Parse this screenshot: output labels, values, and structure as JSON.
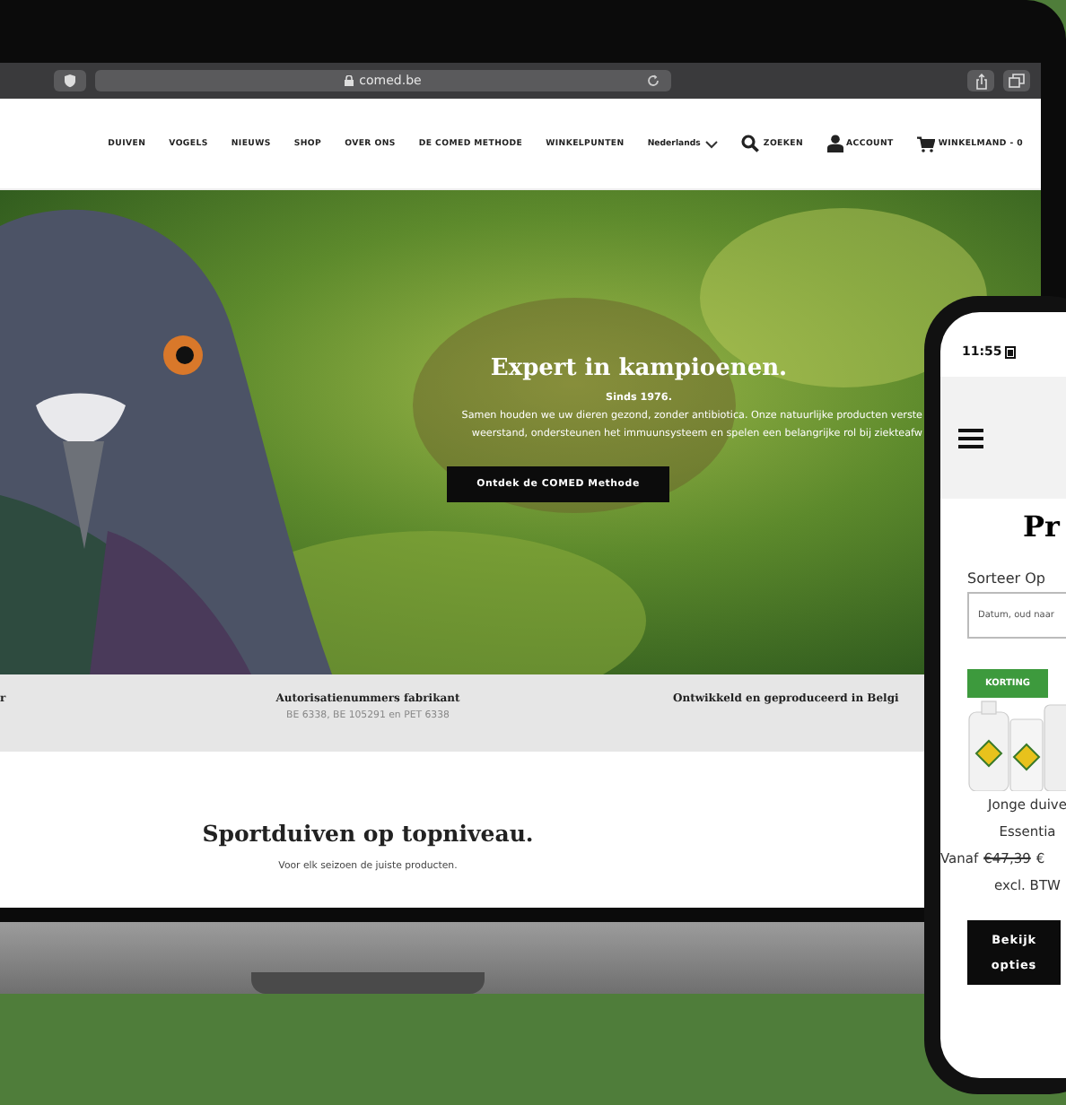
{
  "browser": {
    "address": "comed.be"
  },
  "nav": {
    "items": [
      {
        "label": "DUIVEN"
      },
      {
        "label": "VOGELS"
      },
      {
        "label": "NIEUWS"
      },
      {
        "label": "SHOP"
      },
      {
        "label": "OVER ONS"
      },
      {
        "label": "DE COMED METHODE"
      },
      {
        "label": "WINKELPUNTEN"
      }
    ],
    "language": "Nederlands",
    "search": "ZOEKEN",
    "account": "ACCOUNT",
    "cart": "WINKELMAND - 0"
  },
  "hero": {
    "kind": "picture",
    "title": "Expert in kampioenen.",
    "since": "Sinds 1976.",
    "lines": [
      "Samen houden we uw dieren gezond, zonder antibiotica. Onze natuurlijke producten verste",
      "weerstand, ondersteunen het immuunsysteem en spelen een belangrijke rol bij ziekteafw"
    ],
    "button": "Ontdek de COMED Methode"
  },
  "info": [
    {
      "title": "r"
    },
    {
      "title": "Autorisatienummers fabrikant",
      "text": "BE 6338, BE 105291 en PET 6338"
    },
    {
      "title": "Ontwikkeld en geproduceerd in Belgi"
    }
  ],
  "section": {
    "title": "Sportduiven op topniveau.",
    "subtitle": "Voor elk seizoen de juiste producten."
  },
  "phone": {
    "time": "11:55",
    "heading": "Pr",
    "sort_label": "Sorteer Op",
    "sort_value": "Datum, oud naar",
    "badge": "KORTING",
    "product_lines": [
      "Jonge duive",
      "Essentia"
    ],
    "price_prefix": "Vanaf",
    "old_price": "€47,39",
    "new_price": "€",
    "vat": "excl. BTW",
    "button": "Bekijk opties"
  }
}
